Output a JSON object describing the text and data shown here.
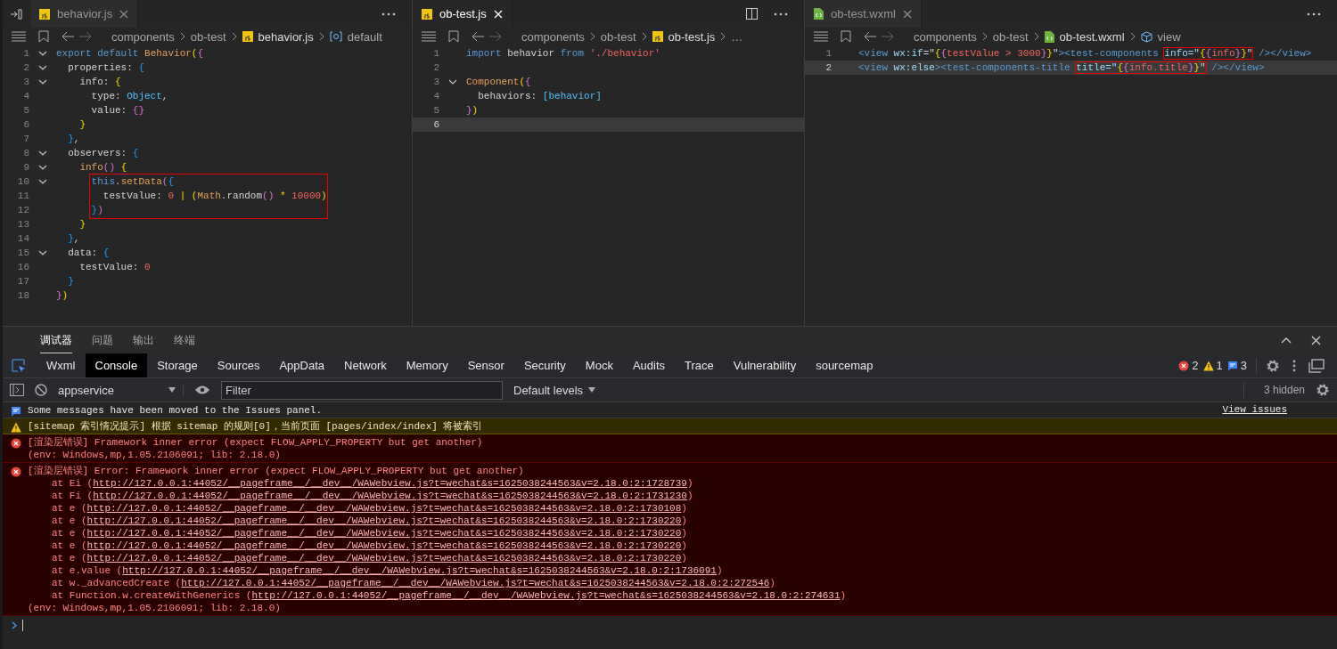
{
  "editors": [
    {
      "tab": {
        "label": "behavior.js",
        "kind": "js",
        "active": false
      },
      "breadcrumb": [
        {
          "label": "components"
        },
        {
          "label": "ob-test"
        },
        {
          "label": "behavior.js",
          "kind": "js-file"
        },
        {
          "label": "default",
          "kind": "symbol"
        }
      ],
      "lines": [
        {
          "n": "1",
          "fold": true,
          "tokens": [
            {
              "text": "export default ",
              "kind": "kw"
            },
            {
              "text": "Behavior",
              "kind": "fn"
            },
            {
              "text": "(",
              "kind": "b1"
            },
            {
              "text": "{",
              "kind": "b2"
            }
          ]
        },
        {
          "n": "2",
          "fold": true,
          "tokens": [
            {
              "text": "  properties: ",
              "kind": "prop"
            },
            {
              "text": "{",
              "kind": "b3"
            }
          ]
        },
        {
          "n": "3",
          "fold": true,
          "tokens": [
            {
              "text": "    info: ",
              "kind": "prop"
            },
            {
              "text": "{",
              "kind": "b1"
            }
          ]
        },
        {
          "n": "4",
          "tokens": [
            {
              "text": "      type: ",
              "kind": "prop"
            },
            {
              "text": "Object",
              "kind": "type"
            },
            {
              "text": ",",
              "kind": "prop"
            }
          ]
        },
        {
          "n": "5",
          "tokens": [
            {
              "text": "      value: ",
              "kind": "prop"
            },
            {
              "text": "{}",
              "kind": "b2"
            }
          ]
        },
        {
          "n": "6",
          "tokens": [
            {
              "text": "    }",
              "kind": "b1"
            }
          ]
        },
        {
          "n": "7",
          "tokens": [
            {
              "text": "  }",
              "kind": "b3"
            },
            {
              "text": ",",
              "kind": "prop"
            }
          ]
        },
        {
          "n": "8",
          "fold": true,
          "tokens": [
            {
              "text": "  observers: ",
              "kind": "prop"
            },
            {
              "text": "{",
              "kind": "b3"
            }
          ]
        },
        {
          "n": "9",
          "fold": true,
          "tokens": [
            {
              "text": "    info",
              "kind": "fn"
            },
            {
              "text": "() ",
              "kind": "b2"
            },
            {
              "text": "{",
              "kind": "b1"
            }
          ]
        },
        {
          "kind": "box",
          "lines": [
            {
              "n": "10",
              "fold": true,
              "tokens": [
                {
                  "text": "      this",
                  "kind": "kw"
                },
                {
                  "text": ".",
                  "kind": "prop"
                },
                {
                  "text": "setData",
                  "kind": "fn"
                },
                {
                  "text": "(",
                  "kind": "b2"
                },
                {
                  "text": "{",
                  "kind": "b3"
                }
              ]
            },
            {
              "n": "11",
              "tokens": [
                {
                  "text": "        testValue: ",
                  "kind": "prop"
                },
                {
                  "text": "0",
                  "kind": "num"
                },
                {
                  "text": " | ",
                  "kind": "b1"
                },
                {
                  "text": "(",
                  "kind": "b1"
                },
                {
                  "text": "Math",
                  "kind": "fn"
                },
                {
                  "text": ".random",
                  "kind": "prop"
                },
                {
                  "text": "()",
                  "kind": "b2"
                },
                {
                  "text": " * ",
                  "kind": "b1"
                },
                {
                  "text": "10000",
                  "kind": "num"
                },
                {
                  "text": ")",
                  "kind": "b1"
                }
              ]
            },
            {
              "n": "12",
              "tokens": [
                {
                  "text": "      }",
                  "kind": "b3"
                },
                {
                  "text": ")",
                  "kind": "b2"
                }
              ]
            }
          ]
        },
        {
          "n": "13",
          "tokens": [
            {
              "text": "    }",
              "kind": "b1"
            }
          ]
        },
        {
          "n": "14",
          "tokens": [
            {
              "text": "  }",
              "kind": "b3"
            },
            {
              "text": ",",
              "kind": "prop"
            }
          ]
        },
        {
          "n": "15",
          "fold": true,
          "tokens": [
            {
              "text": "  data: ",
              "kind": "prop"
            },
            {
              "text": "{",
              "kind": "b3"
            }
          ]
        },
        {
          "n": "16",
          "tokens": [
            {
              "text": "    testValue: ",
              "kind": "prop"
            },
            {
              "text": "0",
              "kind": "num"
            }
          ]
        },
        {
          "n": "17",
          "tokens": [
            {
              "text": "  }",
              "kind": "b3"
            }
          ]
        },
        {
          "n": "18",
          "tokens": [
            {
              "text": "}",
              "kind": "b2"
            },
            {
              "text": ")",
              "kind": "b1"
            }
          ]
        }
      ]
    },
    {
      "tab": {
        "label": "ob-test.js",
        "kind": "js",
        "active": true
      },
      "breadcrumb": [
        {
          "label": "components"
        },
        {
          "label": "ob-test"
        },
        {
          "label": "ob-test.js",
          "kind": "js-file"
        },
        {
          "label": "…"
        }
      ],
      "lines": [
        {
          "n": "1",
          "tokens": [
            {
              "text": "import ",
              "kind": "kw"
            },
            {
              "text": "behavior ",
              "kind": "prop"
            },
            {
              "text": "from ",
              "kind": "kw"
            },
            {
              "text": "'./behavior'",
              "kind": "str"
            }
          ]
        },
        {
          "n": "2"
        },
        {
          "n": "3",
          "fold": true,
          "tokens": [
            {
              "text": "Component",
              "kind": "fn"
            },
            {
              "text": "(",
              "kind": "b1"
            },
            {
              "text": "{",
              "kind": "b2"
            }
          ]
        },
        {
          "n": "4",
          "tokens": [
            {
              "text": "  behaviors: ",
              "kind": "prop"
            },
            {
              "text": "[behavior]",
              "kind": "type"
            }
          ]
        },
        {
          "n": "5",
          "tokens": [
            {
              "text": "}",
              "kind": "b2"
            },
            {
              "text": ")",
              "kind": "b1"
            }
          ]
        },
        {
          "n": "6",
          "current": true
        }
      ]
    },
    {
      "tab": {
        "label": "ob-test.wxml",
        "kind": "wxml",
        "active": false
      },
      "breadcrumb": [
        {
          "label": "components"
        },
        {
          "label": "ob-test"
        },
        {
          "label": "ob-test.wxml",
          "kind": "wxml-file"
        },
        {
          "label": "view",
          "kind": "element"
        }
      ],
      "lines": [
        {
          "n": "1",
          "tokens": [
            {
              "text": "<view",
              "kind": "tag"
            },
            {
              "text": " wx:if",
              "kind": "attr"
            },
            {
              "text": "=\"",
              "kind": "prop"
            },
            {
              "text": "{",
              "kind": "b1"
            },
            {
              "text": "{",
              "kind": "b2"
            },
            {
              "text": "testValue > 3000",
              "kind": "num"
            },
            {
              "text": "}",
              "kind": "b2"
            },
            {
              "text": "}",
              "kind": "b1"
            },
            {
              "text": "\"",
              "kind": "prop"
            },
            {
              "text": ">",
              "kind": "tag"
            },
            {
              "text": "<test-components ",
              "kind": "tag"
            },
            {
              "kind": "box",
              "tokens": [
                {
                  "text": "info=\"",
                  "kind": "attr"
                },
                {
                  "text": "{",
                  "kind": "b1"
                },
                {
                  "text": "{",
                  "kind": "b2"
                },
                {
                  "text": "info",
                  "kind": "num"
                },
                {
                  "text": "}",
                  "kind": "b2"
                },
                {
                  "text": "}",
                  "kind": "b1"
                },
                {
                  "text": "\"",
                  "kind": "prop"
                }
              ]
            },
            {
              "text": " /></view>",
              "kind": "tag"
            }
          ]
        },
        {
          "n": "2",
          "current": true,
          "tokens": [
            {
              "text": "<view",
              "kind": "tag"
            },
            {
              "text": " wx:else",
              "kind": "attr"
            },
            {
              "text": ">",
              "kind": "tag"
            },
            {
              "text": "<test-components-title ",
              "kind": "tag"
            },
            {
              "kind": "box",
              "tokens": [
                {
                  "text": "title=\"",
                  "kind": "attr"
                },
                {
                  "text": "{",
                  "kind": "b1"
                },
                {
                  "text": "{",
                  "kind": "b2"
                },
                {
                  "text": "info.title",
                  "kind": "num"
                },
                {
                  "text": "}",
                  "kind": "b2"
                },
                {
                  "text": "}",
                  "kind": "b1"
                },
                {
                  "text": "\"",
                  "kind": "prop"
                }
              ]
            },
            {
              "text": " /></view>",
              "kind": "tag"
            }
          ]
        }
      ]
    }
  ],
  "panel": {
    "tabs": [
      {
        "label": "调试器",
        "selected": true
      },
      {
        "label": "问题",
        "selected": false
      },
      {
        "label": "输出",
        "selected": false
      },
      {
        "label": "终端",
        "selected": false
      }
    ],
    "devtools_tabs": [
      {
        "label": "Wxml",
        "selected": false
      },
      {
        "label": "Console",
        "selected": true
      },
      {
        "label": "Storage",
        "selected": false
      },
      {
        "label": "Sources",
        "selected": false
      },
      {
        "label": "AppData",
        "selected": false
      },
      {
        "label": "Network",
        "selected": false
      },
      {
        "label": "Memory",
        "selected": false
      },
      {
        "label": "Sensor",
        "selected": false
      },
      {
        "label": "Security",
        "selected": false
      },
      {
        "label": "Mock",
        "selected": false
      },
      {
        "label": "Audits",
        "selected": false
      },
      {
        "label": "Trace",
        "selected": false
      },
      {
        "label": "Vulnerability",
        "selected": false
      },
      {
        "label": "sourcemap",
        "selected": false
      }
    ],
    "counts": [
      {
        "kind": "error",
        "value": "2"
      },
      {
        "kind": "warning",
        "value": "1"
      },
      {
        "kind": "info",
        "value": "3"
      }
    ],
    "context": "appservice",
    "filter_placeholder": "Filter",
    "levels": "Default levels",
    "hidden": "3 hidden",
    "messages": [
      {
        "kind": "info",
        "lines": [
          {
            "text": "Some messages have been moved to the Issues panel."
          }
        ],
        "action": "View issues"
      },
      {
        "kind": "warning",
        "lines": [
          {
            "text": "[sitemap 索引情况提示] 根据 sitemap 的规则[0]，当前页面 [pages/index/index] 将被索引"
          }
        ]
      },
      {
        "kind": "error",
        "lines": [
          {
            "text": "[渲染层错误] Framework inner error (expect FLOW_APPLY_PROPERTY but get another)"
          },
          {
            "text": "(env: Windows,mp,1.05.2106091; lib: 2.18.0)"
          }
        ]
      },
      {
        "kind": "error",
        "lines": [
          {
            "text": "[渲染层错误] Error: Framework inner error (expect FLOW_APPLY_PROPERTY but get another)"
          },
          {
            "pre": "at Ei (",
            "link": "http://127.0.0.1:44052/__pageframe__/__dev__/WAWebview.js?t=wechat&s=1625038244563&v=2.18.0:2:1728739",
            "post": ")"
          },
          {
            "pre": "at Fi (",
            "link": "http://127.0.0.1:44052/__pageframe__/__dev__/WAWebview.js?t=wechat&s=1625038244563&v=2.18.0:2:1731230",
            "post": ")"
          },
          {
            "pre": "at e (",
            "link": "http://127.0.0.1:44052/__pageframe__/__dev__/WAWebview.js?t=wechat&s=1625038244563&v=2.18.0:2:1730108",
            "post": ")"
          },
          {
            "pre": "at e (",
            "link": "http://127.0.0.1:44052/__pageframe__/__dev__/WAWebview.js?t=wechat&s=1625038244563&v=2.18.0:2:1730220",
            "post": ")"
          },
          {
            "pre": "at e (",
            "link": "http://127.0.0.1:44052/__pageframe__/__dev__/WAWebview.js?t=wechat&s=1625038244563&v=2.18.0:2:1730220",
            "post": ")"
          },
          {
            "pre": "at e (",
            "link": "http://127.0.0.1:44052/__pageframe__/__dev__/WAWebview.js?t=wechat&s=1625038244563&v=2.18.0:2:1730220",
            "post": ")"
          },
          {
            "pre": "at e (",
            "link": "http://127.0.0.1:44052/__pageframe__/__dev__/WAWebview.js?t=wechat&s=1625038244563&v=2.18.0:2:1730220",
            "post": ")"
          },
          {
            "pre": "at e.value (",
            "link": "http://127.0.0.1:44052/__pageframe__/__dev__/WAWebview.js?t=wechat&s=1625038244563&v=2.18.0:2:1736091",
            "post": ")"
          },
          {
            "pre": "at w._advancedCreate (",
            "link": "http://127.0.0.1:44052/__pageframe__/__dev__/WAWebview.js?t=wechat&s=1625038244563&v=2.18.0:2:272546",
            "post": ")"
          },
          {
            "pre": "at Function.w.createWithGenerics (",
            "link": "http://127.0.0.1:44052/__pageframe__/__dev__/WAWebview.js?t=wechat&s=1625038244563&v=2.18.0:2:274631",
            "post": ")"
          },
          {
            "text": "(env: Windows,mp,1.05.2106091; lib: 2.18.0)"
          }
        ]
      }
    ]
  }
}
